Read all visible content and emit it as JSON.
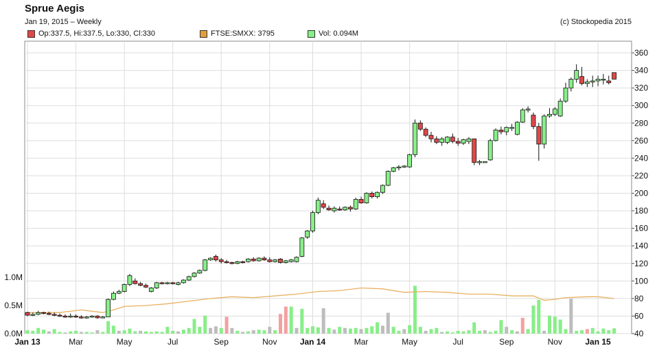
{
  "header": {
    "title": "Sprue Aegis",
    "subtitle": "Jan 19, 2015 – Weekly",
    "copyright": "(c) Stockopedia 2015"
  },
  "legend": [
    {
      "label": "Op:337.5, Hi:337.5, Lo:330, Cl:330",
      "color": "#e04848"
    },
    {
      "label": "FTSE:SMXX: 3795",
      "color": "#e0a040"
    },
    {
      "label": "Vol: 0.094M",
      "color": "#88ee88"
    }
  ],
  "chart_data": {
    "type": "candlestick",
    "price_axis": {
      "ticks": [
        40,
        60,
        80,
        100,
        120,
        140,
        160,
        180,
        200,
        220,
        240,
        260,
        280,
        300,
        320,
        340,
        360
      ],
      "ylim": [
        40,
        368
      ]
    },
    "volume_axis": {
      "ticks": [
        0,
        0.5,
        1.0
      ],
      "tick_labels": [
        "0.0M",
        "0.5M",
        "1.0M"
      ],
      "ylim": [
        0,
        1.0
      ]
    },
    "x_ticks": [
      {
        "index": 0,
        "label": "Jan 13",
        "bold": true
      },
      {
        "index": 9,
        "label": "Mar",
        "bold": false
      },
      {
        "index": 18,
        "label": "May",
        "bold": false
      },
      {
        "index": 27,
        "label": "Jul",
        "bold": false
      },
      {
        "index": 36,
        "label": "Sep",
        "bold": false
      },
      {
        "index": 45,
        "label": "Nov",
        "bold": false
      },
      {
        "index": 53,
        "label": "Jan 14",
        "bold": true
      },
      {
        "index": 62,
        "label": "Mar",
        "bold": false
      },
      {
        "index": 71,
        "label": "May",
        "bold": false
      },
      {
        "index": 80,
        "label": "Jul",
        "bold": false
      },
      {
        "index": 89,
        "label": "Sep",
        "bold": false
      },
      {
        "index": 98,
        "label": "Nov",
        "bold": false
      },
      {
        "index": 106,
        "label": "Jan 15",
        "bold": true
      }
    ],
    "candles": [
      [
        64,
        65,
        60,
        61
      ],
      [
        61,
        64,
        60,
        62
      ],
      [
        62,
        66,
        61,
        64
      ],
      [
        64,
        65,
        62,
        63
      ],
      [
        63,
        65,
        61,
        62
      ],
      [
        62,
        64,
        60,
        61
      ],
      [
        61,
        63,
        59,
        60
      ],
      [
        60,
        62,
        58,
        59
      ],
      [
        59,
        63,
        58,
        60
      ],
      [
        60,
        62,
        58,
        59
      ],
      [
        59,
        61,
        57,
        58
      ],
      [
        58,
        60,
        57,
        59
      ],
      [
        59,
        61,
        58,
        60
      ],
      [
        60,
        61,
        57,
        58
      ],
      [
        58,
        60,
        58,
        59
      ],
      [
        59,
        80,
        59,
        79
      ],
      [
        79,
        88,
        78,
        86
      ],
      [
        86,
        90,
        85,
        88
      ],
      [
        88,
        97,
        87,
        96
      ],
      [
        96,
        108,
        94,
        106
      ],
      [
        100,
        103,
        96,
        97
      ],
      [
        97,
        99,
        94,
        95
      ],
      [
        95,
        97,
        92,
        93
      ],
      [
        88,
        93,
        87,
        92
      ],
      [
        92,
        99,
        91,
        98
      ],
      [
        98,
        99,
        96,
        97
      ],
      [
        97,
        99,
        96,
        98
      ],
      [
        98,
        99,
        96,
        97
      ],
      [
        96,
        99,
        95,
        98
      ],
      [
        98,
        102,
        97,
        101
      ],
      [
        101,
        106,
        100,
        105
      ],
      [
        105,
        110,
        104,
        109
      ],
      [
        109,
        113,
        108,
        112
      ],
      [
        112,
        125,
        111,
        124
      ],
      [
        124,
        127,
        123,
        126
      ],
      [
        128,
        130,
        122,
        124
      ],
      [
        124,
        126,
        120,
        122
      ],
      [
        122,
        124,
        120,
        121
      ],
      [
        121,
        122,
        119,
        120
      ],
      [
        120,
        123,
        119,
        122
      ],
      [
        122,
        123,
        120,
        121
      ],
      [
        122,
        126,
        121,
        125
      ],
      [
        125,
        127,
        122,
        123
      ],
      [
        123,
        127,
        122,
        126
      ],
      [
        126,
        128,
        123,
        124
      ],
      [
        124,
        127,
        121,
        122
      ],
      [
        122,
        125,
        121,
        124
      ],
      [
        125,
        126,
        120,
        121
      ],
      [
        121,
        124,
        120,
        123
      ],
      [
        122,
        125,
        121,
        124
      ],
      [
        122,
        128,
        121,
        127
      ],
      [
        128,
        150,
        127,
        149
      ],
      [
        150,
        158,
        148,
        157
      ],
      [
        157,
        180,
        155,
        178
      ],
      [
        178,
        195,
        176,
        192
      ],
      [
        188,
        192,
        182,
        184
      ],
      [
        183,
        186,
        180,
        181
      ],
      [
        180,
        185,
        178,
        183
      ],
      [
        182,
        185,
        180,
        181
      ],
      [
        181,
        185,
        180,
        184
      ],
      [
        184,
        186,
        179,
        182
      ],
      [
        182,
        195,
        181,
        193
      ],
      [
        193,
        196,
        188,
        189
      ],
      [
        189,
        201,
        188,
        200
      ],
      [
        200,
        202,
        194,
        196
      ],
      [
        196,
        202,
        194,
        201
      ],
      [
        201,
        210,
        199,
        209
      ],
      [
        209,
        226,
        208,
        225
      ],
      [
        225,
        230,
        224,
        229
      ],
      [
        229,
        232,
        226,
        230
      ],
      [
        230,
        232,
        229,
        231
      ],
      [
        230,
        245,
        229,
        244
      ],
      [
        244,
        284,
        241,
        280
      ],
      [
        280,
        283,
        271,
        273
      ],
      [
        273,
        275,
        264,
        266
      ],
      [
        266,
        270,
        258,
        262
      ],
      [
        262,
        265,
        256,
        258
      ],
      [
        258,
        264,
        254,
        262
      ],
      [
        258,
        265,
        256,
        264
      ],
      [
        264,
        268,
        257,
        259
      ],
      [
        259,
        263,
        254,
        257
      ],
      [
        257,
        262,
        255,
        261
      ],
      [
        259,
        264,
        256,
        262
      ],
      [
        262,
        262,
        232,
        235
      ],
      [
        235,
        238,
        232,
        236
      ],
      [
        236,
        236,
        235,
        236
      ],
      [
        238,
        262,
        237,
        260
      ],
      [
        260,
        274,
        259,
        272
      ],
      [
        272,
        276,
        267,
        270
      ],
      [
        270,
        276,
        266,
        275
      ],
      [
        275,
        279,
        271,
        275
      ],
      [
        267,
        282,
        266,
        281
      ],
      [
        281,
        297,
        280,
        295
      ],
      [
        295,
        299,
        292,
        296
      ],
      [
        289,
        292,
        273,
        276
      ],
      [
        276,
        280,
        237,
        256
      ],
      [
        256,
        290,
        251,
        288
      ],
      [
        288,
        297,
        286,
        290
      ],
      [
        290,
        298,
        288,
        296
      ],
      [
        288,
        308,
        287,
        305
      ],
      [
        305,
        326,
        303,
        320
      ],
      [
        320,
        332,
        316,
        330
      ],
      [
        330,
        347,
        326,
        340
      ],
      [
        333,
        344,
        323,
        325
      ],
      [
        325,
        330,
        321,
        327
      ],
      [
        327,
        334,
        321,
        328
      ],
      [
        328,
        334,
        322,
        330
      ],
      [
        330,
        336,
        324,
        330
      ],
      [
        328,
        334,
        324,
        326
      ],
      [
        337.5,
        337.5,
        330,
        330
      ]
    ],
    "volume": [
      {
        "v": 0.06,
        "c": "g"
      },
      {
        "v": 0.05,
        "c": "g"
      },
      {
        "v": 0.1,
        "c": "g"
      },
      {
        "v": 0.07,
        "c": "g"
      },
      {
        "v": 0.04,
        "c": "x"
      },
      {
        "v": 0.08,
        "c": "g"
      },
      {
        "v": 0.03,
        "c": "g"
      },
      {
        "v": 0.02,
        "c": "x"
      },
      {
        "v": 0.04,
        "c": "g"
      },
      {
        "v": 0.05,
        "c": "g"
      },
      {
        "v": 0.03,
        "c": "x"
      },
      {
        "v": 0.03,
        "c": "g"
      },
      {
        "v": 0.02,
        "c": "g"
      },
      {
        "v": 0.06,
        "c": "x"
      },
      {
        "v": 0.03,
        "c": "g"
      },
      {
        "v": 0.22,
        "c": "g"
      },
      {
        "v": 0.14,
        "c": "g"
      },
      {
        "v": 0.05,
        "c": "x"
      },
      {
        "v": 0.06,
        "c": "g"
      },
      {
        "v": 0.09,
        "c": "g"
      },
      {
        "v": 0.04,
        "c": "g"
      },
      {
        "v": 0.05,
        "c": "x"
      },
      {
        "v": 0.04,
        "c": "g"
      },
      {
        "v": 0.03,
        "c": "g"
      },
      {
        "v": 0.04,
        "c": "g"
      },
      {
        "v": 0.03,
        "c": "g"
      },
      {
        "v": 0.12,
        "c": "g"
      },
      {
        "v": 0.05,
        "c": "g"
      },
      {
        "v": 0.04,
        "c": "x"
      },
      {
        "v": 0.07,
        "c": "g"
      },
      {
        "v": 0.1,
        "c": "g"
      },
      {
        "v": 0.26,
        "c": "g"
      },
      {
        "v": 0.12,
        "c": "g"
      },
      {
        "v": 0.32,
        "c": "g"
      },
      {
        "v": 0.1,
        "c": "x"
      },
      {
        "v": 0.13,
        "c": "x"
      },
      {
        "v": 0.1,
        "c": "g"
      },
      {
        "v": 0.3,
        "c": "r"
      },
      {
        "v": 0.1,
        "c": "x"
      },
      {
        "v": 0.05,
        "c": "g"
      },
      {
        "v": 0.03,
        "c": "x"
      },
      {
        "v": 0.04,
        "c": "g"
      },
      {
        "v": 0.06,
        "c": "x"
      },
      {
        "v": 0.07,
        "c": "g"
      },
      {
        "v": 0.06,
        "c": "g"
      },
      {
        "v": 0.12,
        "c": "x"
      },
      {
        "v": 0.06,
        "c": "g"
      },
      {
        "v": 0.35,
        "c": "r"
      },
      {
        "v": 0.48,
        "c": "r"
      },
      {
        "v": 0.48,
        "c": "g"
      },
      {
        "v": 0.1,
        "c": "x"
      },
      {
        "v": 0.44,
        "c": "g"
      },
      {
        "v": 0.1,
        "c": "g"
      },
      {
        "v": 0.13,
        "c": "g"
      },
      {
        "v": 0.11,
        "c": "g"
      },
      {
        "v": 0.45,
        "c": "x"
      },
      {
        "v": 0.1,
        "c": "g"
      },
      {
        "v": 0.07,
        "c": "x"
      },
      {
        "v": 0.12,
        "c": "g"
      },
      {
        "v": 0.1,
        "c": "x"
      },
      {
        "v": 0.09,
        "c": "g"
      },
      {
        "v": 0.1,
        "c": "g"
      },
      {
        "v": 0.08,
        "c": "x"
      },
      {
        "v": 0.1,
        "c": "g"
      },
      {
        "v": 0.13,
        "c": "g"
      },
      {
        "v": 0.2,
        "c": "g"
      },
      {
        "v": 0.14,
        "c": "x"
      },
      {
        "v": 0.37,
        "c": "x"
      },
      {
        "v": 0.12,
        "c": "g"
      },
      {
        "v": 0.05,
        "c": "g"
      },
      {
        "v": 0.08,
        "c": "x"
      },
      {
        "v": 0.15,
        "c": "g"
      },
      {
        "v": 0.85,
        "c": "g"
      },
      {
        "v": 0.12,
        "c": "g"
      },
      {
        "v": 0.05,
        "c": "x"
      },
      {
        "v": 0.08,
        "c": "g"
      },
      {
        "v": 0.1,
        "c": "g"
      },
      {
        "v": 0.03,
        "c": "x"
      },
      {
        "v": 0.04,
        "c": "g"
      },
      {
        "v": 0.02,
        "c": "g"
      },
      {
        "v": 0.05,
        "c": "g"
      },
      {
        "v": 0.04,
        "c": "g"
      },
      {
        "v": 0.06,
        "c": "g"
      },
      {
        "v": 0.2,
        "c": "g"
      },
      {
        "v": 0.05,
        "c": "g"
      },
      {
        "v": 0.06,
        "c": "x"
      },
      {
        "v": 0.03,
        "c": "g"
      },
      {
        "v": 0.05,
        "c": "g"
      },
      {
        "v": 0.24,
        "c": "g"
      },
      {
        "v": 0.12,
        "c": "x"
      },
      {
        "v": 0.06,
        "c": "g"
      },
      {
        "v": 0.04,
        "c": "x"
      },
      {
        "v": 0.28,
        "c": "r"
      },
      {
        "v": 0.08,
        "c": "g"
      },
      {
        "v": 0.5,
        "c": "g"
      },
      {
        "v": 0.6,
        "c": "g"
      },
      {
        "v": 0.05,
        "c": "x"
      },
      {
        "v": 0.32,
        "c": "g"
      },
      {
        "v": 0.3,
        "c": "g"
      },
      {
        "v": 0.25,
        "c": "g"
      },
      {
        "v": 0.08,
        "c": "g"
      },
      {
        "v": 0.62,
        "c": "x"
      },
      {
        "v": 0.05,
        "c": "g"
      },
      {
        "v": 0.06,
        "c": "g"
      },
      {
        "v": 0.08,
        "c": "r"
      },
      {
        "v": 0.1,
        "c": "g"
      },
      {
        "v": 0.04,
        "c": "g"
      },
      {
        "v": 0.09,
        "c": "g"
      },
      {
        "v": 0.06,
        "c": "g"
      },
      {
        "v": 0.094,
        "c": "g"
      }
    ],
    "ftse_line": [
      {
        "i": 0,
        "y": 64
      },
      {
        "i": 6,
        "y": 64
      },
      {
        "i": 10,
        "y": 67
      },
      {
        "i": 14,
        "y": 64
      },
      {
        "i": 16,
        "y": 67
      },
      {
        "i": 18,
        "y": 71
      },
      {
        "i": 22,
        "y": 72
      },
      {
        "i": 26,
        "y": 74
      },
      {
        "i": 30,
        "y": 77
      },
      {
        "i": 34,
        "y": 80
      },
      {
        "i": 38,
        "y": 82
      },
      {
        "i": 42,
        "y": 81
      },
      {
        "i": 46,
        "y": 83
      },
      {
        "i": 50,
        "y": 85
      },
      {
        "i": 54,
        "y": 88
      },
      {
        "i": 58,
        "y": 89
      },
      {
        "i": 62,
        "y": 92
      },
      {
        "i": 66,
        "y": 91
      },
      {
        "i": 70,
        "y": 87
      },
      {
        "i": 74,
        "y": 88
      },
      {
        "i": 78,
        "y": 87
      },
      {
        "i": 82,
        "y": 85
      },
      {
        "i": 86,
        "y": 85
      },
      {
        "i": 90,
        "y": 83
      },
      {
        "i": 94,
        "y": 83
      },
      {
        "i": 96,
        "y": 78
      },
      {
        "i": 98,
        "y": 79
      },
      {
        "i": 100,
        "y": 81
      },
      {
        "i": 104,
        "y": 82
      },
      {
        "i": 106,
        "y": 82
      },
      {
        "i": 109,
        "y": 80
      }
    ],
    "colors": {
      "up": "#88ee88",
      "down": "#e04848",
      "neutral": "#bdbdbd",
      "ftse": "#e8b060",
      "grid": "#dddddd"
    }
  }
}
